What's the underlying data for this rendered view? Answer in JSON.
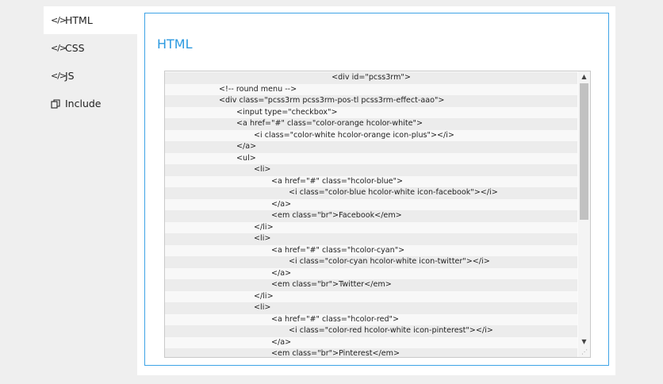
{
  "sidebar": {
    "items": [
      {
        "icon": "code-icon",
        "label": "HTML",
        "active": true
      },
      {
        "icon": "code-icon",
        "label": "CSS",
        "active": false
      },
      {
        "icon": "code-icon",
        "label": "JS",
        "active": false
      },
      {
        "icon": "copy-icon",
        "label": "Include",
        "active": false
      }
    ]
  },
  "panel": {
    "title": "HTML"
  },
  "code": {
    "lines": [
      "<div id=\"pcss3rm\">",
      "<!-- round menu -->",
      "<div class=\"pcss3rm pcss3rm-pos-tl pcss3rm-effect-aao\">",
      "<input type=\"checkbox\">",
      "<a href=\"#\" class=\"color-orange hcolor-white\">",
      "<i class=\"color-white hcolor-orange icon-plus\"></i>",
      "</a>",
      "<ul>",
      "<li>",
      "<a href=\"#\" class=\"hcolor-blue\">",
      "<i class=\"color-blue hcolor-white icon-facebook\"></i>",
      "</a>",
      "<em class=\"br\">Facebook</em>",
      "</li>",
      "<li>",
      "<a href=\"#\" class=\"hcolor-cyan\">",
      "<i class=\"color-cyan hcolor-white icon-twitter\"></i>",
      "</a>",
      "<em class=\"br\">Twitter</em>",
      "</li>",
      "<li>",
      "<a href=\"#\" class=\"hcolor-red\">",
      "<i class=\"color-red hcolor-white icon-pinterest\"></i>",
      "</a>",
      "<em class=\"br\">Pinterest</em>"
    ]
  },
  "colors": {
    "accent": "#2c9ae0",
    "panel_border": "#3ea3e6",
    "page_bg": "#efefef"
  }
}
